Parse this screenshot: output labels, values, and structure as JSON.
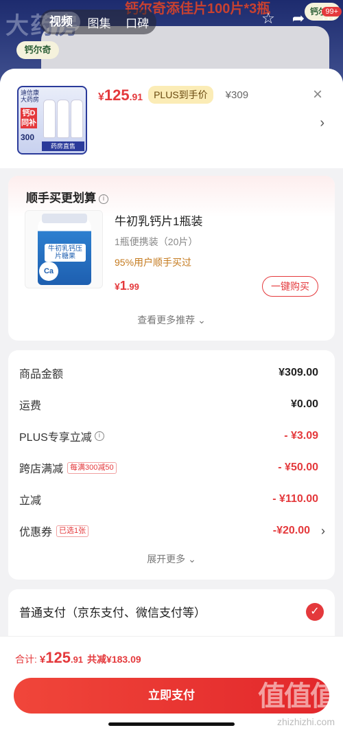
{
  "background": {
    "brand_big": "大药房",
    "promo_text": "钙尔奇添佳片100片*3瓶",
    "logo_chip": "钙尔奇",
    "logo_chip_right": "钙尔奇",
    "media_tabs": [
      "视频",
      "图集",
      "口碑"
    ],
    "cart_badge": "99+"
  },
  "product": {
    "thumb": {
      "top_text": "迪信康 大药房",
      "red_label": "钙D 同补",
      "count": "300",
      "bar_text": "药房直售"
    },
    "price_yen": "¥",
    "price_int": "125",
    "price_dec": ".91",
    "plus_tag": "PLUS到手价",
    "original_price": "¥309"
  },
  "addon": {
    "title": "顺手买更划算",
    "item_name": "牛初乳钙片1瓶装",
    "item_spec": "1瓶便携装（20片）",
    "social_proof": "95%用户顺手买过",
    "price_yen": "¥",
    "price_int": "1",
    "price_dec": ".99",
    "buy_button": "一键购买",
    "see_more": "查看更多推荐",
    "bottle_label": "牛初乳钙压片糖果",
    "bottle_ca": "Ca"
  },
  "summary": {
    "rows": [
      {
        "label": "商品金额",
        "value": "¥309.00"
      },
      {
        "label": "运费",
        "value": "¥0.00"
      },
      {
        "label": "PLUS专享立减",
        "value": "- ¥3.09"
      },
      {
        "label": "跨店满减",
        "tag": "每满300减50",
        "value": "- ¥50.00"
      },
      {
        "label": "立减",
        "value": "- ¥110.00"
      },
      {
        "label": "优惠券",
        "tag": "已选1张",
        "value": "-¥20.00"
      }
    ],
    "expand_more": "展开更多"
  },
  "payment": {
    "method": "普通支付（京东支付、微信支付等）"
  },
  "bottom": {
    "total_label": "合计:",
    "total_yen": "¥",
    "total_int": "125",
    "total_dec": ".91",
    "total_discount": "共减¥183.09",
    "pay_button": "立即支付",
    "watermark": "值值值",
    "watermark_url": "zhizhizhi.com"
  },
  "colors": {
    "accent": "#e4393c",
    "plus_tag_bg": "#fbecb6",
    "social_proof": "#c47a1e"
  }
}
